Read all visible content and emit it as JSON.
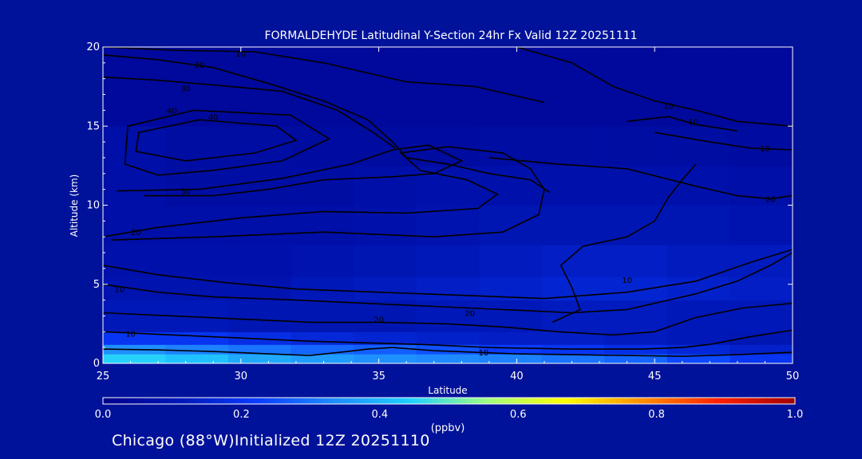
{
  "chart_data": {
    "type": "heatmap",
    "title": "FORMALDEHYDE Latitudinal Y-Section 24hr  Fx Valid 12Z 20251111",
    "xlabel": "Latitude",
    "ylabel": "Altitude (km)",
    "xlim": [
      25,
      50
    ],
    "ylim": [
      0,
      20
    ],
    "x_ticks": [
      "25",
      "30",
      "35",
      "40",
      "45",
      "50"
    ],
    "y_ticks": [
      "0",
      "5",
      "10",
      "15",
      "20"
    ],
    "colorbar": {
      "min": 0.0,
      "max": 1.0,
      "ticks": [
        "0.0",
        "0.2",
        "0.4",
        "0.6",
        "0.8",
        "1.0"
      ],
      "unit_label": "(ppbv)",
      "colors": [
        "#00008a",
        "#0018b8",
        "#0a3cff",
        "#1f8cff",
        "#20d0ff",
        "#a0ff80",
        "#ffff00",
        "#ff9000",
        "#ff2000",
        "#a00000"
      ]
    },
    "fill_bands": [
      {
        "alt_from": 0.0,
        "alt_to": 0.6,
        "values": [
          0.45,
          0.42,
          0.38,
          0.36,
          0.34,
          0.33,
          0.32,
          0.3,
          0.28,
          0.24,
          0.2
        ]
      },
      {
        "alt_from": 0.6,
        "alt_to": 1.2,
        "values": [
          0.34,
          0.32,
          0.3,
          0.28,
          0.27,
          0.25,
          0.22,
          0.2,
          0.18,
          0.16,
          0.14
        ]
      },
      {
        "alt_from": 1.2,
        "alt_to": 2.0,
        "values": [
          0.2,
          0.2,
          0.18,
          0.16,
          0.15,
          0.14,
          0.13,
          0.13,
          0.12,
          0.11,
          0.1
        ]
      },
      {
        "alt_from": 2.0,
        "alt_to": 4.0,
        "values": [
          0.11,
          0.11,
          0.1,
          0.1,
          0.1,
          0.11,
          0.11,
          0.12,
          0.12,
          0.11,
          0.11
        ]
      },
      {
        "alt_from": 4.0,
        "alt_to": 5.5,
        "values": [
          0.09,
          0.09,
          0.09,
          0.11,
          0.12,
          0.13,
          0.14,
          0.15,
          0.15,
          0.14,
          0.13
        ]
      },
      {
        "alt_from": 5.5,
        "alt_to": 7.5,
        "values": [
          0.08,
          0.08,
          0.08,
          0.09,
          0.1,
          0.11,
          0.12,
          0.13,
          0.13,
          0.12,
          0.12
        ]
      },
      {
        "alt_from": 7.5,
        "alt_to": 10.0,
        "values": [
          0.07,
          0.07,
          0.07,
          0.07,
          0.08,
          0.09,
          0.1,
          0.1,
          0.1,
          0.1,
          0.09
        ]
      },
      {
        "alt_from": 10.0,
        "alt_to": 12.5,
        "values": [
          0.07,
          0.06,
          0.06,
          0.06,
          0.07,
          0.08,
          0.08,
          0.08,
          0.08,
          0.08,
          0.07
        ]
      },
      {
        "alt_from": 12.5,
        "alt_to": 15.0,
        "values": [
          0.07,
          0.06,
          0.06,
          0.05,
          0.05,
          0.05,
          0.06,
          0.06,
          0.06,
          0.06,
          0.05
        ]
      },
      {
        "alt_from": 15.0,
        "alt_to": 20.0,
        "values": [
          0.04,
          0.04,
          0.04,
          0.04,
          0.04,
          0.04,
          0.04,
          0.04,
          0.04,
          0.04,
          0.04
        ]
      }
    ],
    "contours": [
      {
        "label": "40",
        "label_at": [
          29.0,
          15.6
        ],
        "points": [
          [
            28.0,
            12.8
          ],
          [
            26.2,
            13.4
          ],
          [
            26.3,
            14.6
          ],
          [
            28.5,
            15.4
          ],
          [
            31.3,
            15.0
          ],
          [
            32.0,
            14.1
          ],
          [
            30.5,
            13.3
          ],
          [
            28.0,
            12.8
          ]
        ]
      },
      {
        "label": "40",
        "label_at": [
          27.5,
          16.0
        ],
        "points": [
          [
            27.0,
            11.9
          ],
          [
            25.8,
            12.6
          ],
          [
            25.9,
            15.0
          ],
          [
            28.3,
            16.0
          ],
          [
            31.8,
            15.7
          ],
          [
            33.2,
            14.2
          ],
          [
            31.5,
            12.8
          ],
          [
            29.0,
            12.2
          ],
          [
            27.0,
            11.9
          ]
        ]
      },
      {
        "label": "30",
        "label_at": [
          28.0,
          10.9
        ],
        "points": [
          [
            25.5,
            10.9
          ],
          [
            28.5,
            11.0
          ],
          [
            31.5,
            11.7
          ],
          [
            34.0,
            12.6
          ],
          [
            35.5,
            13.5
          ],
          [
            36.8,
            13.8
          ],
          [
            38.0,
            12.8
          ],
          [
            37.0,
            12.0
          ],
          [
            35.5,
            11.8
          ],
          [
            33.0,
            11.6
          ],
          [
            31.0,
            11.0
          ],
          [
            29.0,
            10.6
          ],
          [
            26.5,
            10.6
          ]
        ]
      },
      {
        "label": "20",
        "label_at": [
          26.2,
          8.3
        ],
        "points": [
          [
            25.0,
            8.0
          ],
          [
            27.0,
            8.6
          ],
          [
            30.0,
            9.2
          ],
          [
            33.0,
            9.6
          ],
          [
            36.0,
            9.5
          ],
          [
            38.6,
            9.8
          ],
          [
            39.3,
            10.7
          ],
          [
            38.2,
            11.6
          ],
          [
            36.5,
            12.2
          ],
          [
            35.8,
            13.3
          ],
          [
            37.5,
            13.7
          ],
          [
            39.5,
            13.3
          ],
          [
            40.5,
            12.3
          ],
          [
            41.0,
            11.0
          ],
          [
            40.8,
            9.4
          ],
          [
            39.5,
            8.3
          ],
          [
            37.0,
            8.0
          ],
          [
            33.0,
            8.3
          ],
          [
            29.0,
            8.0
          ],
          [
            25.3,
            7.8
          ]
        ]
      },
      {
        "label": "10",
        "label_at": [
          25.6,
          4.7
        ],
        "points": [
          [
            25.0,
            5.0
          ],
          [
            27.0,
            4.5
          ],
          [
            29.0,
            4.2
          ],
          [
            32.0,
            4.0
          ],
          [
            34.5,
            3.8
          ],
          [
            37.0,
            3.6
          ],
          [
            39.5,
            3.4
          ],
          [
            42.0,
            3.2
          ],
          [
            44.0,
            3.4
          ],
          [
            45.5,
            4.0
          ],
          [
            46.5,
            4.4
          ],
          [
            48.0,
            5.2
          ],
          [
            49.2,
            6.2
          ],
          [
            50.0,
            7.0
          ]
        ]
      },
      {
        "label": "10",
        "label_at": [
          38.8,
          0.7
        ],
        "points": [
          [
            25.0,
            0.9
          ],
          [
            27.0,
            0.85
          ],
          [
            29.0,
            0.75
          ],
          [
            31.0,
            0.6
          ],
          [
            32.5,
            0.5
          ],
          [
            33.6,
            0.7
          ],
          [
            34.6,
            0.9
          ],
          [
            35.5,
            1.0
          ],
          [
            37.0,
            0.8
          ],
          [
            38.5,
            0.7
          ],
          [
            40.0,
            0.6
          ],
          [
            42.0,
            0.55
          ],
          [
            44.0,
            0.5
          ],
          [
            46.0,
            0.45
          ],
          [
            48.0,
            0.55
          ],
          [
            50.0,
            0.7
          ]
        ]
      },
      {
        "label": "20",
        "label_at": [
          38.3,
          3.2
        ],
        "points": [
          [
            25.0,
            6.2
          ],
          [
            27.0,
            5.6
          ],
          [
            29.5,
            5.1
          ],
          [
            32.0,
            4.7
          ],
          [
            35.0,
            4.5
          ],
          [
            38.0,
            4.3
          ],
          [
            41.0,
            4.1
          ],
          [
            44.0,
            4.5
          ],
          [
            46.5,
            5.2
          ],
          [
            48.5,
            6.4
          ],
          [
            50.0,
            7.2
          ]
        ]
      },
      {
        "label": "10",
        "label_at": [
          44.0,
          5.3
        ],
        "points": [
          [
            41.3,
            2.6
          ],
          [
            42.3,
            3.4
          ],
          [
            42.0,
            4.8
          ],
          [
            41.6,
            6.2
          ],
          [
            42.4,
            7.4
          ],
          [
            44.0,
            8.0
          ],
          [
            45.0,
            9.0
          ],
          [
            45.5,
            10.5
          ],
          [
            46.0,
            11.6
          ],
          [
            46.5,
            12.6
          ]
        ]
      },
      {
        "label": "20",
        "label_at": [
          49.2,
          10.4
        ],
        "points": [
          [
            39.0,
            13.0
          ],
          [
            41.5,
            12.6
          ],
          [
            44.0,
            12.3
          ],
          [
            46.5,
            11.2
          ],
          [
            48.0,
            10.6
          ],
          [
            49.2,
            10.4
          ],
          [
            50.0,
            10.6
          ]
        ]
      },
      {
        "label": "10",
        "label_at": [
          49.0,
          13.6
        ],
        "points": [
          [
            45.0,
            14.6
          ],
          [
            47.0,
            14.0
          ],
          [
            48.5,
            13.6
          ],
          [
            50.0,
            13.5
          ]
        ]
      },
      {
        "label": "10",
        "label_at": [
          45.5,
          16.3
        ],
        "points": [
          [
            40.0,
            20.0
          ],
          [
            42.0,
            19.0
          ],
          [
            43.5,
            17.5
          ],
          [
            45.0,
            16.6
          ],
          [
            46.5,
            16.0
          ],
          [
            48.0,
            15.3
          ],
          [
            50.0,
            15.0
          ]
        ]
      },
      {
        "label": "10",
        "label_at": [
          46.4,
          15.3
        ],
        "points": [
          [
            44.0,
            15.3
          ],
          [
            45.5,
            15.6
          ],
          [
            46.5,
            15.1
          ],
          [
            48.0,
            14.7
          ]
        ]
      },
      {
        "label": "20",
        "label_at": [
          28.5,
          18.9
        ],
        "points": [
          [
            25.0,
            19.5
          ],
          [
            27.0,
            19.2
          ],
          [
            29.0,
            18.7
          ],
          [
            31.0,
            17.7
          ],
          [
            33.0,
            16.6
          ],
          [
            34.6,
            15.4
          ],
          [
            35.5,
            14.0
          ],
          [
            36.0,
            13.0
          ],
          [
            37.5,
            12.6
          ],
          [
            39.0,
            12.0
          ],
          [
            40.5,
            11.6
          ],
          [
            41.2,
            10.8
          ]
        ]
      },
      {
        "label": "30",
        "label_at": [
          28.0,
          17.4
        ],
        "points": [
          [
            25.0,
            18.1
          ],
          [
            27.0,
            17.9
          ],
          [
            29.0,
            17.6
          ],
          [
            31.5,
            17.2
          ],
          [
            33.5,
            16.0
          ],
          [
            34.8,
            14.6
          ],
          [
            35.6,
            13.6
          ]
        ]
      },
      {
        "label": "10",
        "label_at": [
          30.0,
          19.6
        ],
        "points": [
          [
            25.0,
            20.0
          ],
          [
            27.5,
            19.8
          ],
          [
            30.5,
            19.7
          ],
          [
            33.0,
            19.0
          ],
          [
            36.0,
            17.8
          ],
          [
            38.5,
            17.5
          ],
          [
            41.0,
            16.5
          ]
        ]
      },
      {
        "label": "10",
        "label_at": [
          26.0,
          1.9
        ],
        "points": [
          [
            25.0,
            2.0
          ],
          [
            27.5,
            1.8
          ],
          [
            30.0,
            1.6
          ],
          [
            32.5,
            1.4
          ],
          [
            34.5,
            1.3
          ],
          [
            36.5,
            1.2
          ],
          [
            39.0,
            1.0
          ],
          [
            42.0,
            0.9
          ],
          [
            44.5,
            0.9
          ],
          [
            46.0,
            1.0
          ],
          [
            47.0,
            1.2
          ],
          [
            48.5,
            1.7
          ],
          [
            50.0,
            2.1
          ]
        ]
      },
      {
        "label": "20",
        "label_at": [
          35.0,
          2.8
        ],
        "points": [
          [
            25.0,
            3.2
          ],
          [
            27.5,
            3.0
          ],
          [
            30.0,
            2.8
          ],
          [
            32.5,
            2.6
          ],
          [
            35.0,
            2.6
          ],
          [
            37.5,
            2.5
          ],
          [
            39.5,
            2.3
          ],
          [
            41.5,
            2.0
          ],
          [
            43.5,
            1.8
          ],
          [
            45.0,
            2.0
          ],
          [
            46.5,
            2.9
          ],
          [
            48.2,
            3.5
          ],
          [
            50.0,
            3.8
          ]
        ]
      }
    ]
  },
  "footer": {
    "text": "Chicago (88°W)Initialized 12Z 20251110"
  }
}
